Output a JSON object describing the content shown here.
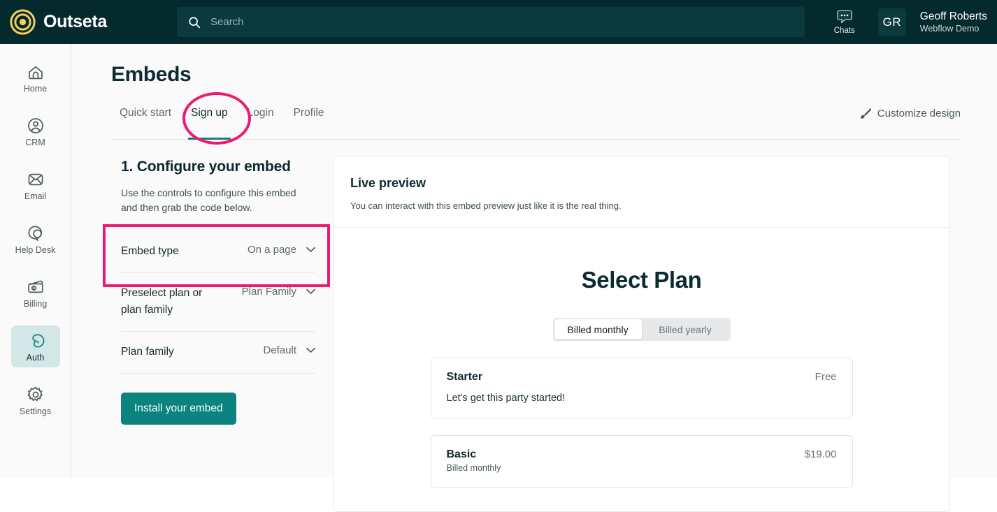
{
  "topbar": {
    "brand_name": "Outseta",
    "logo_icon": "outseta-target-logo",
    "brand_color": "#f5cf5b",
    "search": {
      "placeholder": "Search",
      "icon": "search-icon"
    },
    "chats": {
      "label": "Chats",
      "icon": "chat-bubble-ellipsis-icon"
    },
    "user": {
      "initials": "GR",
      "name": "Geoff Roberts",
      "org": "Webflow Demo"
    },
    "bg_color": "#052a2e"
  },
  "sidebar": {
    "items": [
      {
        "label": "Home",
        "icon": "home-icon",
        "active": false
      },
      {
        "label": "CRM",
        "icon": "user-circle-icon",
        "active": false
      },
      {
        "label": "Email",
        "icon": "envelope-icon",
        "active": false
      },
      {
        "label": "Help Desk",
        "icon": "chat-support-icon",
        "active": false
      },
      {
        "label": "Billing",
        "icon": "credit-card-icon",
        "active": false
      },
      {
        "label": "Auth",
        "icon": "auth-key-icon",
        "active": true
      },
      {
        "label": "Settings",
        "icon": "gear-icon",
        "active": false
      }
    ],
    "active_bg": "#d3e8e6"
  },
  "page": {
    "title": "Embeds",
    "tabs": [
      {
        "label": "Quick start",
        "active": false
      },
      {
        "label": "Sign up",
        "active": true
      },
      {
        "label": "Login",
        "active": false
      },
      {
        "label": "Profile",
        "active": false
      }
    ],
    "active_tab_underline_color": "#0f7f7d",
    "customize": {
      "label": "Customize design",
      "icon": "paintbrush-icon"
    }
  },
  "config": {
    "heading": "1. Configure your embed",
    "subtext": "Use the controls to configure this embed and then grab the code below.",
    "controls": [
      {
        "label": "Embed type",
        "value": "On a page",
        "icon": "chevron-down-icon"
      },
      {
        "label": "Preselect plan or plan family",
        "value": "Plan Family",
        "icon": "chevron-down-icon"
      },
      {
        "label": "Plan family",
        "value": "Default",
        "icon": "chevron-down-icon"
      }
    ],
    "install_button": "Install your embed",
    "install_button_color": "#0b837f"
  },
  "preview": {
    "title": "Live preview",
    "description": "You can interact with this embed preview just like it is the real thing.",
    "embed": {
      "heading": "Select Plan",
      "billing_toggle": [
        {
          "label": "Billed monthly",
          "selected": true
        },
        {
          "label": "Billed yearly",
          "selected": false
        }
      ],
      "plans": [
        {
          "name": "Starter",
          "price": "Free",
          "billing": "",
          "description": "Let's get this party started!"
        },
        {
          "name": "Basic",
          "price": "$19.00",
          "billing": "Billed monthly",
          "description": ""
        }
      ]
    }
  },
  "annotations": {
    "color": "#ed1a72",
    "ellipse_target": "Sign up",
    "rect_target": "Embed type"
  }
}
